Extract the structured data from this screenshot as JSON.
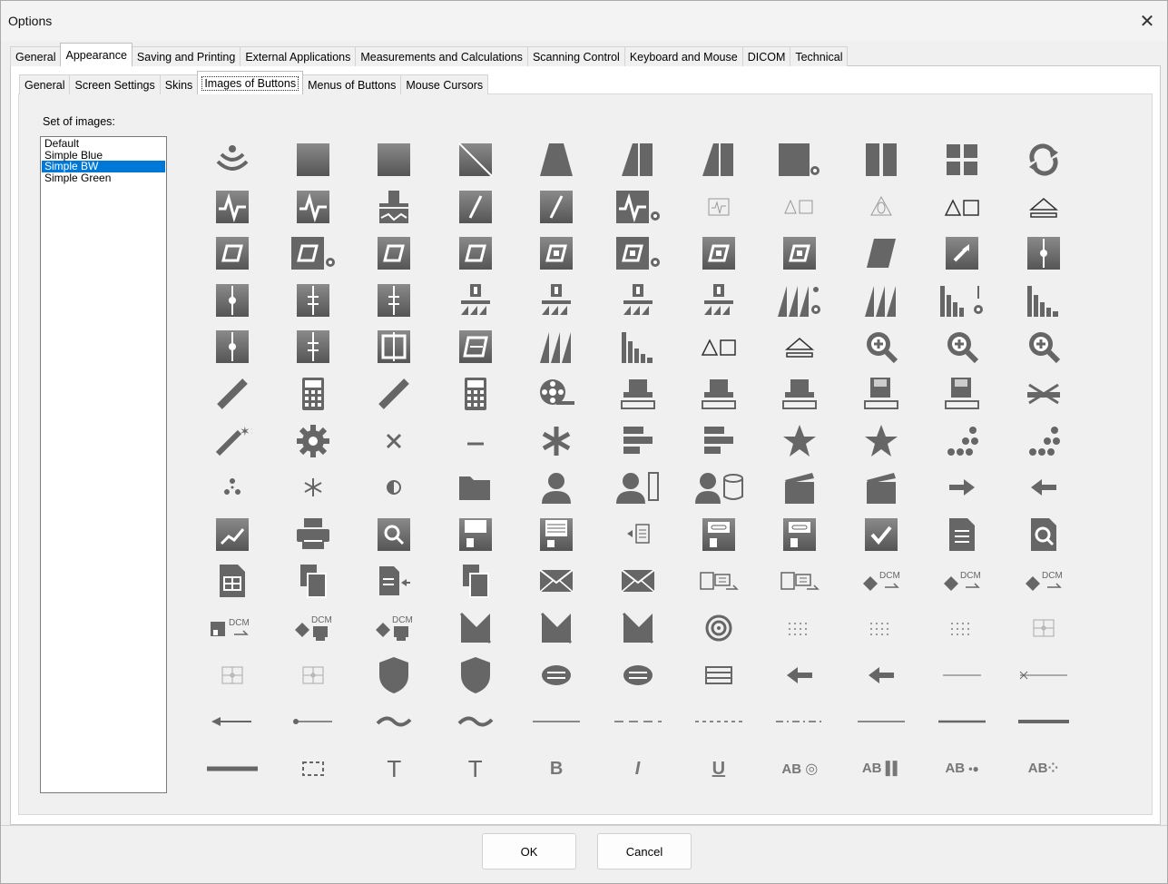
{
  "window": {
    "title": "Options",
    "close_glyph": "✕"
  },
  "main_tabs": [
    {
      "label": "General"
    },
    {
      "label": "Appearance",
      "active": true
    },
    {
      "label": "Saving and Printing"
    },
    {
      "label": "External Applications"
    },
    {
      "label": "Measurements and Calculations"
    },
    {
      "label": "Scanning Control"
    },
    {
      "label": "Keyboard and Mouse"
    },
    {
      "label": "DICOM"
    },
    {
      "label": "Technical"
    }
  ],
  "sub_tabs": [
    {
      "label": "General"
    },
    {
      "label": "Screen Settings"
    },
    {
      "label": "Skins"
    },
    {
      "label": "Images of Buttons",
      "active": true
    },
    {
      "label": "Menus of Buttons"
    },
    {
      "label": "Mouse Cursors"
    }
  ],
  "image_set": {
    "label": "Set of images:",
    "options": [
      "Default",
      "Simple Blue",
      "Simple BW",
      "Simple Green"
    ],
    "selected": "Simple BW"
  },
  "icon_color": "#666666",
  "selection_color": "#0078d7",
  "icons": [
    [
      "wireless-icon",
      "square-icon",
      "square-icon",
      "diagonal-square-icon",
      "trapezoid-icon",
      "split-trapezoid-icon",
      "split-trapezoid-icon",
      "square-gear-icon",
      "two-columns-icon",
      "four-quadrants-icon",
      "refresh-icon"
    ],
    [
      "waveform-icon",
      "waveform-icon",
      "cursor-wave-icon",
      "slash-square-icon",
      "slash-square-icon",
      "waveform-gear-icon",
      "waveform-small-icon",
      "trace-small-icon",
      "doppler-small-icon",
      "shapes-outline-icon",
      "eject-outline-icon"
    ],
    [
      "parallelogram-icon",
      "parallelogram-gear-icon",
      "parallelogram-icon",
      "parallelogram-icon",
      "parallelogram-dot-icon",
      "parallelogram-dot-gear-icon",
      "parallelogram-dot-icon",
      "parallelogram-dot-icon",
      "parallelogram-solid-icon",
      "arrow-box-icon",
      "vertical-marker-icon"
    ],
    [
      "vertical-marker-icon",
      "double-marker-icon",
      "double-marker-icon",
      "ruler-marker-icon",
      "ruler-marker-icon",
      "ruler-marker-icon",
      "ruler-marker-icon",
      "spectrum-gear-icon",
      "spectrum-icon",
      "histogram-gear-icon",
      "histogram-icon"
    ],
    [
      "vertical-marker-icon",
      "double-marker-icon",
      "bracket-box-icon",
      "slanted-box-icon",
      "spectrum-icon",
      "histogram-icon",
      "shapes-outline-icon",
      "eject-outline-icon",
      "zoom-in-icon",
      "zoom-in-icon",
      "zoom-in-icon"
    ],
    [
      "ruler-icon",
      "calculator-icon",
      "ruler-icon",
      "calculator-icon",
      "film-reel-icon",
      "printer-tray-icon",
      "printer-tray-icon",
      "printer-tray-icon",
      "disk-tray-icon",
      "disk-tray-icon",
      "crossed-tray-icon"
    ],
    [
      "magic-wand-icon",
      "gear-icon",
      "close-icon",
      "minus-icon",
      "asterisk-icon",
      "align-bars-icon",
      "align-bars-icon",
      "star-icon",
      "star-icon",
      "dot-triangle-icon",
      "dot-triangle-icon"
    ],
    [
      "radiation-icon",
      "small-asterisk-icon",
      "contrast-icon",
      "folder-icon",
      "user-icon",
      "user-list-icon",
      "user-database-icon",
      "clapper-icon",
      "clapper-icon",
      "arrow-right-icon",
      "arrow-left-icon"
    ],
    [
      "chart-document-icon",
      "printer-icon",
      "search-document-icon",
      "floppy-icon",
      "floppy-lines-icon",
      "export-document-icon",
      "floppy-drive-icon",
      "floppy-drive-icon",
      "checkmark-icon",
      "text-document-icon",
      "inspect-document-icon"
    ],
    [
      "table-document-icon",
      "copy-document-icon",
      "document-arrow-icon",
      "copy-document-icon",
      "envelope-icon",
      "envelope-icon",
      "send-document-icon",
      "send-document-icon",
      "dcm-send-icon",
      "dcm-send-icon",
      "dcm-send-icon"
    ],
    [
      "dcm-save-icon",
      "dcm-print-icon",
      "dcm-print-icon",
      "hourglass-cross-icon",
      "hourglass-cross-icon",
      "hourglass-cross-icon",
      "target-icon",
      "dotted-grid-icon",
      "dotted-grid-icon",
      "dotted-grid-icon",
      "crosshair-box-icon"
    ],
    [
      "crosshair-box-icon",
      "crosshair-box-icon",
      "shield-icon",
      "shield-icon",
      "oval-lines-icon",
      "oval-lines-icon",
      "list-lines-icon",
      "arrow-left-icon",
      "arrow-left-icon",
      "line-icon",
      "cross-line-icon"
    ],
    [
      "arrow-line-icon",
      "dot-line-icon",
      "tilde-icon",
      "tilde-icon",
      "solid-line-icon",
      "dashed-line-icon",
      "dotted-line-icon",
      "dash-dot-line-icon",
      "solid-line-icon",
      "thick-line-icon",
      "thicker-line-icon"
    ],
    [
      "thickest-line-icon",
      "dashed-rect-icon",
      "serif-t-icon",
      "serif-t-icon",
      "bold-icon",
      "italic-icon",
      "underline-icon",
      "ab-circle-icon",
      "ab-bars-icon",
      "ab-dots-icon",
      "ab-cluster-icon"
    ]
  ],
  "icon_text": {
    "serif_t": "T",
    "bold": "B",
    "italic": "I",
    "underline": "U",
    "ab": "AB",
    "dcm": "DCM"
  },
  "buttons": {
    "ok": "OK",
    "cancel": "Cancel"
  }
}
